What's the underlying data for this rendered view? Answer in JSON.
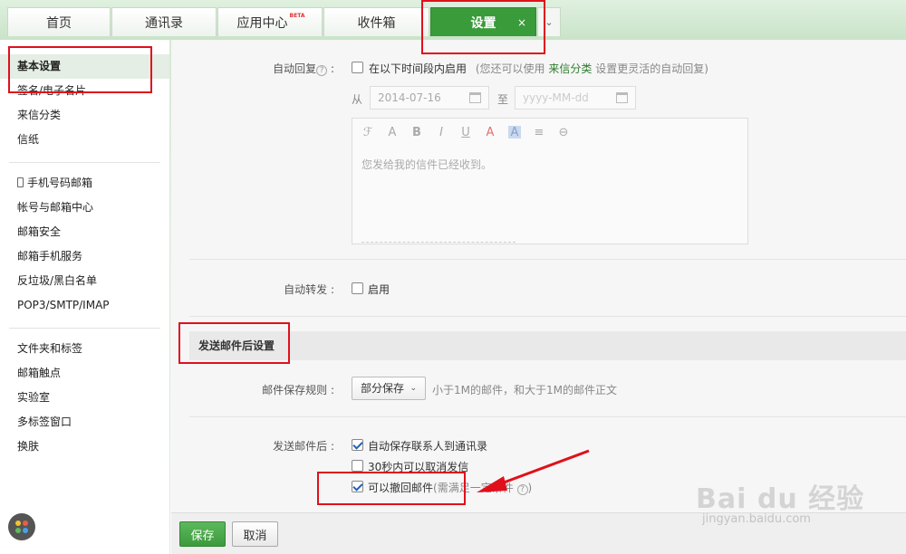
{
  "tabs": [
    {
      "label": "首页"
    },
    {
      "label": "通讯录"
    },
    {
      "label": "应用中心",
      "badge": "BETA"
    },
    {
      "label": "收件箱"
    },
    {
      "label": "设置",
      "active": true,
      "close": "×"
    }
  ],
  "sidebar": {
    "group1": [
      {
        "label": "基本设置",
        "active": true
      },
      {
        "label": "签名/电子名片"
      },
      {
        "label": "来信分类"
      },
      {
        "label": "信纸"
      }
    ],
    "group2": [
      {
        "label": "手机号码邮箱",
        "icon": "phone-icon"
      },
      {
        "label": "帐号与邮箱中心"
      },
      {
        "label": "邮箱安全"
      },
      {
        "label": "邮箱手机服务"
      },
      {
        "label": "反垃圾/黑白名单"
      },
      {
        "label": "POP3/SMTP/IMAP"
      }
    ],
    "group3": [
      {
        "label": "文件夹和标签"
      },
      {
        "label": "邮箱触点"
      },
      {
        "label": "实验室"
      },
      {
        "label": "多标签窗口"
      },
      {
        "label": "换肤"
      }
    ]
  },
  "auto_reply": {
    "label": "自动回复",
    "checkbox_label": "在以下时间段内启用",
    "hint_prefix": "(您还可以使用",
    "hint_link": "来信分类",
    "hint_suffix": "设置更灵活的自动回复)",
    "from_label": "从",
    "from_date": "2014-07-16",
    "to_label": "至",
    "to_placeholder": "yyyy-MM-dd",
    "toolbar_glyphs": [
      "ℱ",
      "A",
      "B",
      "I",
      "U",
      "A",
      "A",
      "≡",
      "⊖"
    ],
    "body_text": "您发给我的信件已经收到。"
  },
  "auto_forward": {
    "label": "自动转发",
    "checkbox_label": "启用"
  },
  "after_send_section": {
    "title": "发送邮件后设置"
  },
  "save_rule": {
    "label": "邮件保存规则",
    "selected": "部分保存",
    "description": "小于1M的邮件，和大于1M的邮件正文"
  },
  "after_send": {
    "label": "发送邮件后",
    "options": [
      {
        "label": "自动保存联系人到通讯录",
        "checked": true
      },
      {
        "label": "30秒内可以取消发信",
        "checked": false
      },
      {
        "label": "可以撤回邮件",
        "note": "(需满足一定条件",
        "checked": true
      }
    ]
  },
  "footer": {
    "save_label": "保存",
    "cancel_label": "取消"
  },
  "watermark": {
    "logo": "Bai du 经验",
    "url": "jingyan.baidu.com"
  },
  "colors": {
    "accent": "#3a9b3a",
    "highlight_box": "#e0101b",
    "link": "#2e7d2e"
  }
}
